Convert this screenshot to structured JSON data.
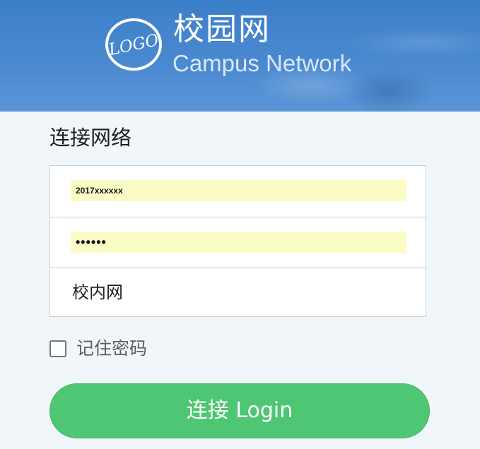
{
  "header": {
    "logo_text": "LOGO",
    "title": "校园网",
    "subtitle": "Campus  Network"
  },
  "form": {
    "section_title": "连接网络",
    "username_value": "2017xxxxxx",
    "password_value": "••••••",
    "network_value": "校内网",
    "remember_label": "记住密码",
    "remember_checked": false,
    "login_label": "连接 Login"
  },
  "colors": {
    "header_blue": "#4a89d0",
    "autofill_yellow": "#fbfbc6",
    "login_green": "#4ec673"
  }
}
